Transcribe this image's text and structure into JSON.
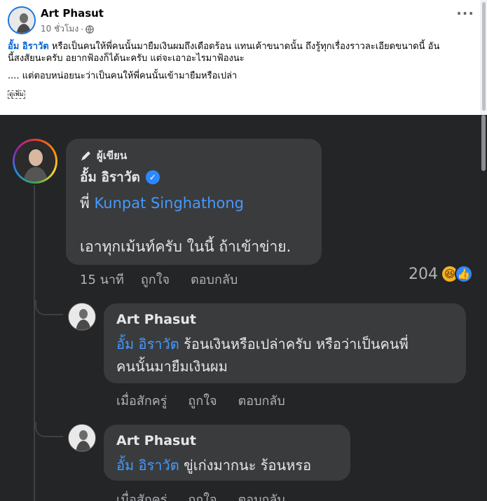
{
  "post": {
    "author": "Art Phasut",
    "time": "10 ชั่วโมง",
    "separator": "·",
    "privacy_icon": "globe-icon",
    "more_icon": "more-options-icon",
    "mention": "อั้ม อิราวัต",
    "text_line1": "หรือเป็นคนให้พี่คนนั้นมายืมเงินผมถึงเดือดร้อน แทนเค้าขนาดนั้น  ถึงรู้ทุกเรื่องราวละเอียดขนาดนี้  อัน",
    "text_line2": "นี้สงสัยนะครับ อยากฟ้องก็ได้นะครับ แต่จะเอาอะไรมาฟ้องนะ",
    "text_line3": ".... แต่ตอบหน่อยนะว่าเป็นคนให้พี่คนนั้นเข้ามายืมหรือเปล่า",
    "see_more": "ดูเพิ่ม"
  },
  "comments": [
    {
      "badge": "ผู้เขียน",
      "badge_icon": "pen-icon",
      "author": "อั้ม อิราวัต",
      "verified_icon": "verified-check-icon",
      "prefix": "พี่",
      "mention": "Kunpat Singhathong",
      "text": "เอาทุกเม้นท์ครับ ในนี้ ถ้าเข้าข่าย.",
      "time": "15 นาที",
      "like": "ถูกใจ",
      "reply": "ตอบกลับ",
      "reaction_count": "204",
      "reaction_icons": [
        "haha-icon",
        "like-icon"
      ]
    },
    {
      "author": "Art Phasut",
      "mention": "อั้ม อิราวัต",
      "text_line1": " ร้อนเงินหรือเปล่าครับ หรือว่าเป็นคนพี่",
      "text_line2": "คนนั้นมายืมเงินผม",
      "time": "เมื่อสักครู่",
      "like": "ถูกใจ",
      "reply": "ตอบกลับ"
    },
    {
      "author": "Art Phasut",
      "mention": "อั้ม อิราวัต",
      "text": " ขู่เก่งมากนะ ร้อนหรอ",
      "time": "เมื่อสักครู่",
      "like": "ถูกใจ",
      "reply": "ตอบกลับ"
    }
  ],
  "colors": {
    "dark_bg": "#242526",
    "bubble": "#3a3b3c",
    "mention_dark": "#4599ff",
    "mention_light": "#0064d1"
  }
}
